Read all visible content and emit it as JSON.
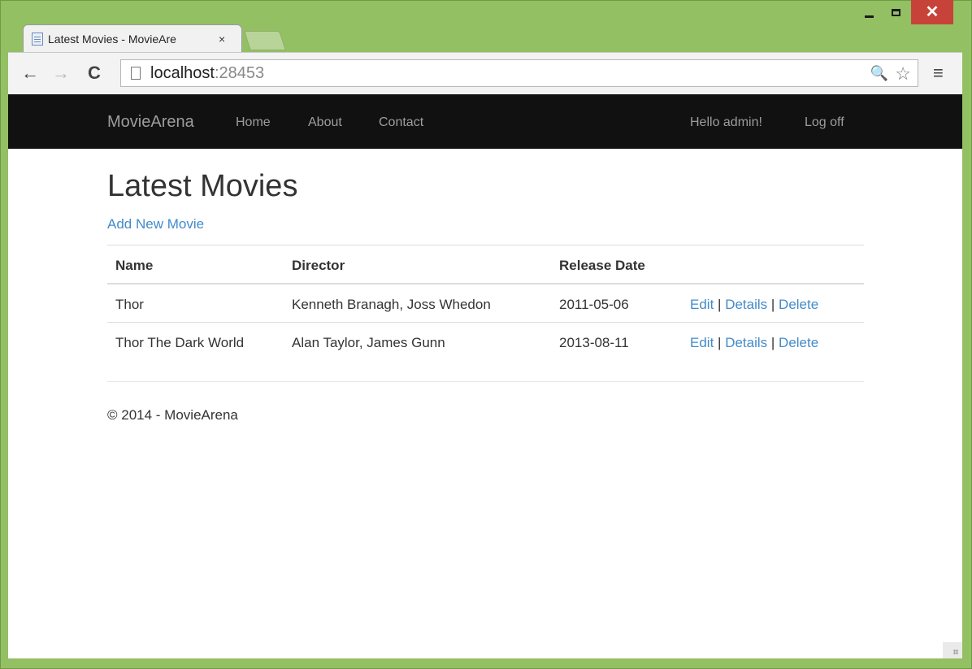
{
  "window": {
    "caption_colors": {
      "frame": "#93c063",
      "close": "#c7433a"
    }
  },
  "tab": {
    "title": "Latest Movies - MovieAre",
    "close_glyph": "×"
  },
  "toolbar": {
    "back_glyph": "←",
    "forward_glyph": "→",
    "reload_glyph": "C",
    "url_host": "localhost",
    "url_port": ":28453",
    "zoom_glyph": "🔍",
    "star_glyph": "☆",
    "menu_glyph": "≡"
  },
  "site": {
    "brand": "MovieArena",
    "nav": {
      "home": "Home",
      "about": "About",
      "contact": "Contact"
    },
    "user": {
      "greeting": "Hello admin!",
      "logoff": "Log off"
    },
    "accent_color": "#428bca"
  },
  "main": {
    "title": "Latest Movies",
    "add_link": "Add New Movie",
    "table": {
      "headers": [
        "Name",
        "Director",
        "Release Date"
      ],
      "rows": [
        {
          "name": "Thor",
          "director": "Kenneth Branagh, Joss Whedon",
          "date": "2011-05-06"
        },
        {
          "name": "Thor The Dark World",
          "director": "Alan Taylor, James Gunn",
          "date": "2013-08-11"
        }
      ],
      "actions": {
        "edit": "Edit",
        "details": "Details",
        "delete": "Delete",
        "sep": "|"
      }
    }
  },
  "footer": {
    "text": "© 2014 - MovieArena"
  }
}
